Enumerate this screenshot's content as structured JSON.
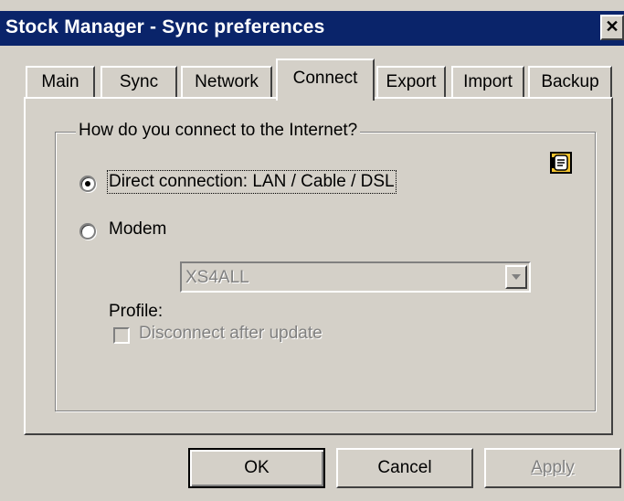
{
  "window": {
    "title": "Stock Manager - Sync preferences",
    "close_glyph": "✕"
  },
  "tabs": [
    {
      "label": "Main"
    },
    {
      "label": "Sync"
    },
    {
      "label": "Network"
    },
    {
      "label": "Connect",
      "active": true
    },
    {
      "label": "Export"
    },
    {
      "label": "Import"
    },
    {
      "label": "Backup"
    }
  ],
  "connect": {
    "group_title": "How do you connect to the Internet?",
    "icon": "phone-connection-icon",
    "options": [
      {
        "label": "Direct connection: LAN / Cable / DSL",
        "selected": true
      },
      {
        "label": "Modem",
        "selected": false
      }
    ],
    "profile": {
      "label": "Profile:",
      "value": "XS4ALL",
      "enabled": false
    },
    "disconnect": {
      "label": "Disconnect after update",
      "checked": false,
      "enabled": false
    }
  },
  "buttons": {
    "ok": "OK",
    "cancel": "Cancel",
    "apply": "Apply"
  },
  "colors": {
    "titlebar": "#0a246a",
    "face": "#d4d0c8",
    "disabled_text": "#808080"
  }
}
